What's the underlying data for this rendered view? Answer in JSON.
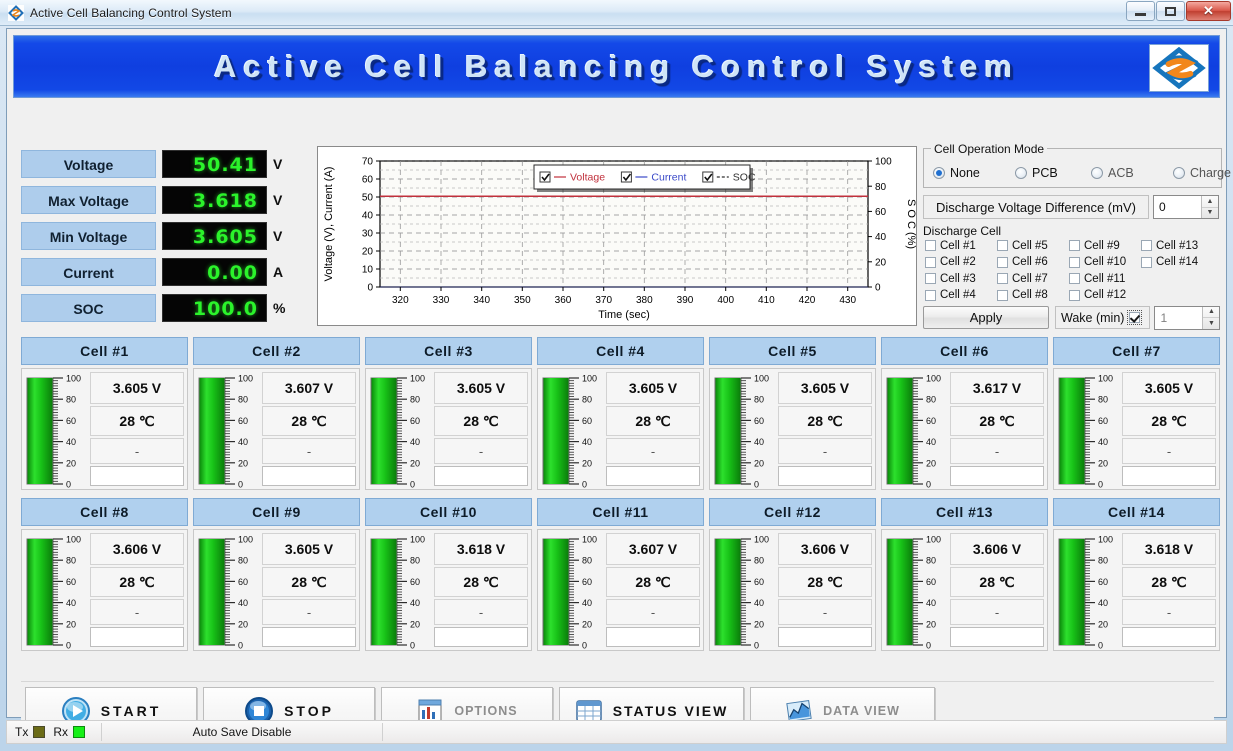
{
  "window": {
    "title": "Active Cell Balancing Control System",
    "icon": "app-logo-icon",
    "controls": {
      "minimize": "minimize-icon",
      "maximize": "maximize-icon",
      "close": "✕"
    }
  },
  "banner": {
    "title": "Active Cell Balancing Control System",
    "logo": "company-logo"
  },
  "readouts": [
    {
      "label": "Voltage",
      "value": "50.41",
      "unit": "V"
    },
    {
      "label": "Max Voltage",
      "value": "3.618",
      "unit": "V"
    },
    {
      "label": "Min Voltage",
      "value": "3.605",
      "unit": "V"
    },
    {
      "label": "Current",
      "value": "0.00",
      "unit": "A"
    },
    {
      "label": "SOC",
      "value": "100.0",
      "unit": "%"
    }
  ],
  "chart_data": {
    "type": "line",
    "title": "",
    "xlabel": "Time (sec)",
    "ylabel": "Voltage (V), Current (A)",
    "y2label": "S O C (%)",
    "xlim": [
      315,
      435
    ],
    "ylim": [
      0,
      70
    ],
    "y2lim": [
      0,
      100
    ],
    "xticks": [
      320,
      330,
      340,
      350,
      360,
      370,
      380,
      390,
      400,
      410,
      420,
      430
    ],
    "yticks": [
      0,
      10,
      20,
      30,
      40,
      50,
      60,
      70
    ],
    "y2ticks": [
      0,
      20,
      40,
      60,
      80,
      100
    ],
    "grid": true,
    "legend_position": "top-center",
    "series": [
      {
        "name": "Voltage",
        "color": "#c0303c",
        "axis": "left",
        "checked": true,
        "constant_value": 50.41
      },
      {
        "name": "Current",
        "color": "#3a49c8",
        "axis": "left",
        "checked": true,
        "constant_value": 0.0
      },
      {
        "name": "SOC",
        "color": "#303030",
        "axis": "right",
        "checked": true,
        "constant_value": 100.0
      }
    ]
  },
  "cell_operation_mode": {
    "legend": "Cell Operation Mode",
    "options": [
      {
        "label": "None",
        "selected": true,
        "enabled": true
      },
      {
        "label": "PCB",
        "selected": false,
        "enabled": true
      },
      {
        "label": "ACB",
        "selected": false,
        "enabled": false
      },
      {
        "label": "Charge",
        "selected": false,
        "enabled": false
      }
    ]
  },
  "discharge_voltage_difference": {
    "label": "Discharge Voltage Difference (mV)",
    "value": "0"
  },
  "discharge_cell": {
    "legend": "Discharge Cell",
    "columns": [
      [
        {
          "label": "Cell #1",
          "checked": false
        },
        {
          "label": "Cell #2",
          "checked": false
        },
        {
          "label": "Cell #3",
          "checked": false
        },
        {
          "label": "Cell #4",
          "checked": false
        }
      ],
      [
        {
          "label": "Cell #5",
          "checked": false
        },
        {
          "label": "Cell #6",
          "checked": false
        },
        {
          "label": "Cell #7",
          "checked": false
        },
        {
          "label": "Cell #8",
          "checked": false
        }
      ],
      [
        {
          "label": "Cell #9",
          "checked": false
        },
        {
          "label": "Cell #10",
          "checked": false
        },
        {
          "label": "Cell #11",
          "checked": false
        },
        {
          "label": "Cell #12",
          "checked": false
        }
      ],
      [
        {
          "label": "Cell #13",
          "checked": false
        },
        {
          "label": "Cell #14",
          "checked": false
        }
      ]
    ]
  },
  "apply_row": {
    "apply_label": "Apply",
    "wake_label": "Wake (min)",
    "wake_checked": true,
    "wake_value": "1"
  },
  "cells": [
    {
      "title": "Cell  #1",
      "voltage": "3.605 V",
      "temperature": "28 ℃",
      "dash": "-",
      "gauge": 100
    },
    {
      "title": "Cell  #2",
      "voltage": "3.607 V",
      "temperature": "28 ℃",
      "dash": "-",
      "gauge": 100
    },
    {
      "title": "Cell  #3",
      "voltage": "3.605 V",
      "temperature": "28 ℃",
      "dash": "-",
      "gauge": 100
    },
    {
      "title": "Cell  #4",
      "voltage": "3.605 V",
      "temperature": "28 ℃",
      "dash": "-",
      "gauge": 100
    },
    {
      "title": "Cell  #5",
      "voltage": "3.605 V",
      "temperature": "28 ℃",
      "dash": "-",
      "gauge": 100
    },
    {
      "title": "Cell  #6",
      "voltage": "3.617 V",
      "temperature": "28 ℃",
      "dash": "-",
      "gauge": 100
    },
    {
      "title": "Cell  #7",
      "voltage": "3.605 V",
      "temperature": "28 ℃",
      "dash": "-",
      "gauge": 100
    },
    {
      "title": "Cell  #8",
      "voltage": "3.606 V",
      "temperature": "28 ℃",
      "dash": "-",
      "gauge": 100
    },
    {
      "title": "Cell  #9",
      "voltage": "3.605 V",
      "temperature": "28 ℃",
      "dash": "-",
      "gauge": 100
    },
    {
      "title": "Cell  #10",
      "voltage": "3.618 V",
      "temperature": "28 ℃",
      "dash": "-",
      "gauge": 100
    },
    {
      "title": "Cell  #11",
      "voltage": "3.607 V",
      "temperature": "28 ℃",
      "dash": "-",
      "gauge": 100
    },
    {
      "title": "Cell  #12",
      "voltage": "3.606 V",
      "temperature": "28 ℃",
      "dash": "-",
      "gauge": 100
    },
    {
      "title": "Cell  #13",
      "voltage": "3.606 V",
      "temperature": "28 ℃",
      "dash": "-",
      "gauge": 100
    },
    {
      "title": "Cell  #14",
      "voltage": "3.618 V",
      "temperature": "28 ℃",
      "dash": "-",
      "gauge": 100
    }
  ],
  "gauge_ticks": [
    "100",
    "80",
    "60",
    "40",
    "20",
    "0"
  ],
  "toolbar": [
    {
      "label": "START",
      "icon": "play-icon",
      "enabled": true
    },
    {
      "label": "STOP",
      "icon": "stop-icon",
      "enabled": true
    },
    {
      "label": "OPTIONS",
      "icon": "options-icon",
      "enabled": false
    },
    {
      "label": "STATUS VIEW",
      "icon": "table-icon",
      "enabled": true
    },
    {
      "label": "DATA VIEW",
      "icon": "graph-icon",
      "enabled": false
    }
  ],
  "statusbar": {
    "tx_label": "Tx",
    "rx_label": "Rx",
    "autosave": "Auto Save Disable"
  },
  "colors": {
    "banner_blue": "#1449e8",
    "cell_header_blue": "#b0d0ee",
    "lcd_green": "#2bf32b",
    "voltage_line": "#c0303c",
    "current_line": "#3a49c8",
    "soc_line": "#303030"
  }
}
